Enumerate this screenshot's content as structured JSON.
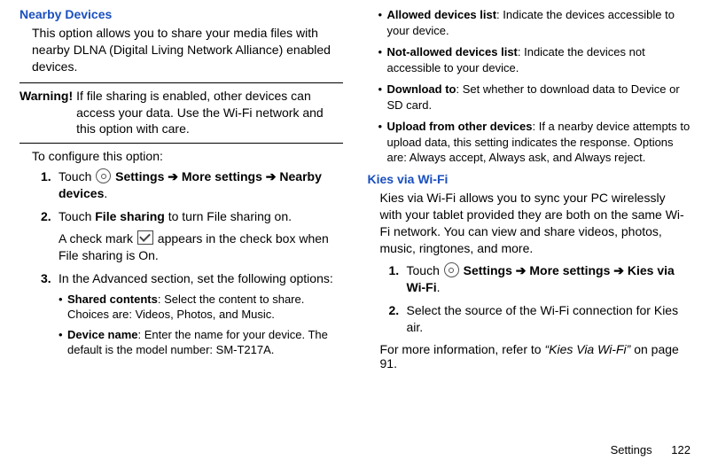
{
  "col1": {
    "heading": "Nearby Devices",
    "intro": "This option allows you to share your media files with nearby DLNA (Digital Living Network Alliance) enabled devices.",
    "warning_label": "Warning!",
    "warning_text": "If file sharing is enabled, other devices can access your data. Use the Wi-Fi network and this option with care.",
    "configure": "To configure this option:",
    "steps": {
      "s1_num": "1.",
      "s1_a": "Touch ",
      "s1_b": " Settings ➔ More settings ➔ Nearby devices",
      "s1_c": ".",
      "s2_num": "2.",
      "s2_a": "Touch ",
      "s2_b": "File sharing",
      "s2_c": " to turn File sharing on.",
      "s2_check_a": "A check mark ",
      "s2_check_b": " appears in the check box when File sharing is On.",
      "s3_num": "3.",
      "s3_text": "In the Advanced section, set the following options:",
      "sub_sc_b": "Shared contents",
      "sub_sc_t": ": Select the content to share. Choices are: Videos, Photos, and Music.",
      "sub_dn_b": "Device name",
      "sub_dn_t": ": Enter the name for your device. The default is the model number: SM-T217A."
    }
  },
  "col2": {
    "bullets": {
      "adl_b": "Allowed devices list",
      "adl_t": ": Indicate the devices accessible to your device.",
      "nadl_b": "Not-allowed devices list",
      "nadl_t": ": Indicate the devices not accessible to your device.",
      "dt_b": "Download to",
      "dt_t": ": Set whether to download data to Device or SD card.",
      "ufod_b": "Upload from other devices",
      "ufod_t": ": If a nearby device attempts to upload data, this setting indicates the response. Options are: Always accept, Always ask, and Always reject."
    },
    "kies_heading": "Kies via Wi-Fi",
    "kies_body": "Kies via Wi-Fi allows you to sync your PC wirelessly with your tablet provided they are both on the same Wi-Fi network. You can view and share videos, photos, music, ringtones, and more.",
    "steps": {
      "s1_num": "1.",
      "s1_a": "Touch ",
      "s1_b": " Settings ➔ More settings ➔ Kies via Wi-Fi",
      "s1_c": ".",
      "s2_num": "2.",
      "s2_text": "Select the source of the Wi-Fi connection for Kies air."
    },
    "ref_a": "For more information, refer to ",
    "ref_quote": "“Kies Via Wi-Fi”",
    "ref_b": " on page 91."
  },
  "footer": {
    "section": "Settings",
    "page": "122"
  }
}
